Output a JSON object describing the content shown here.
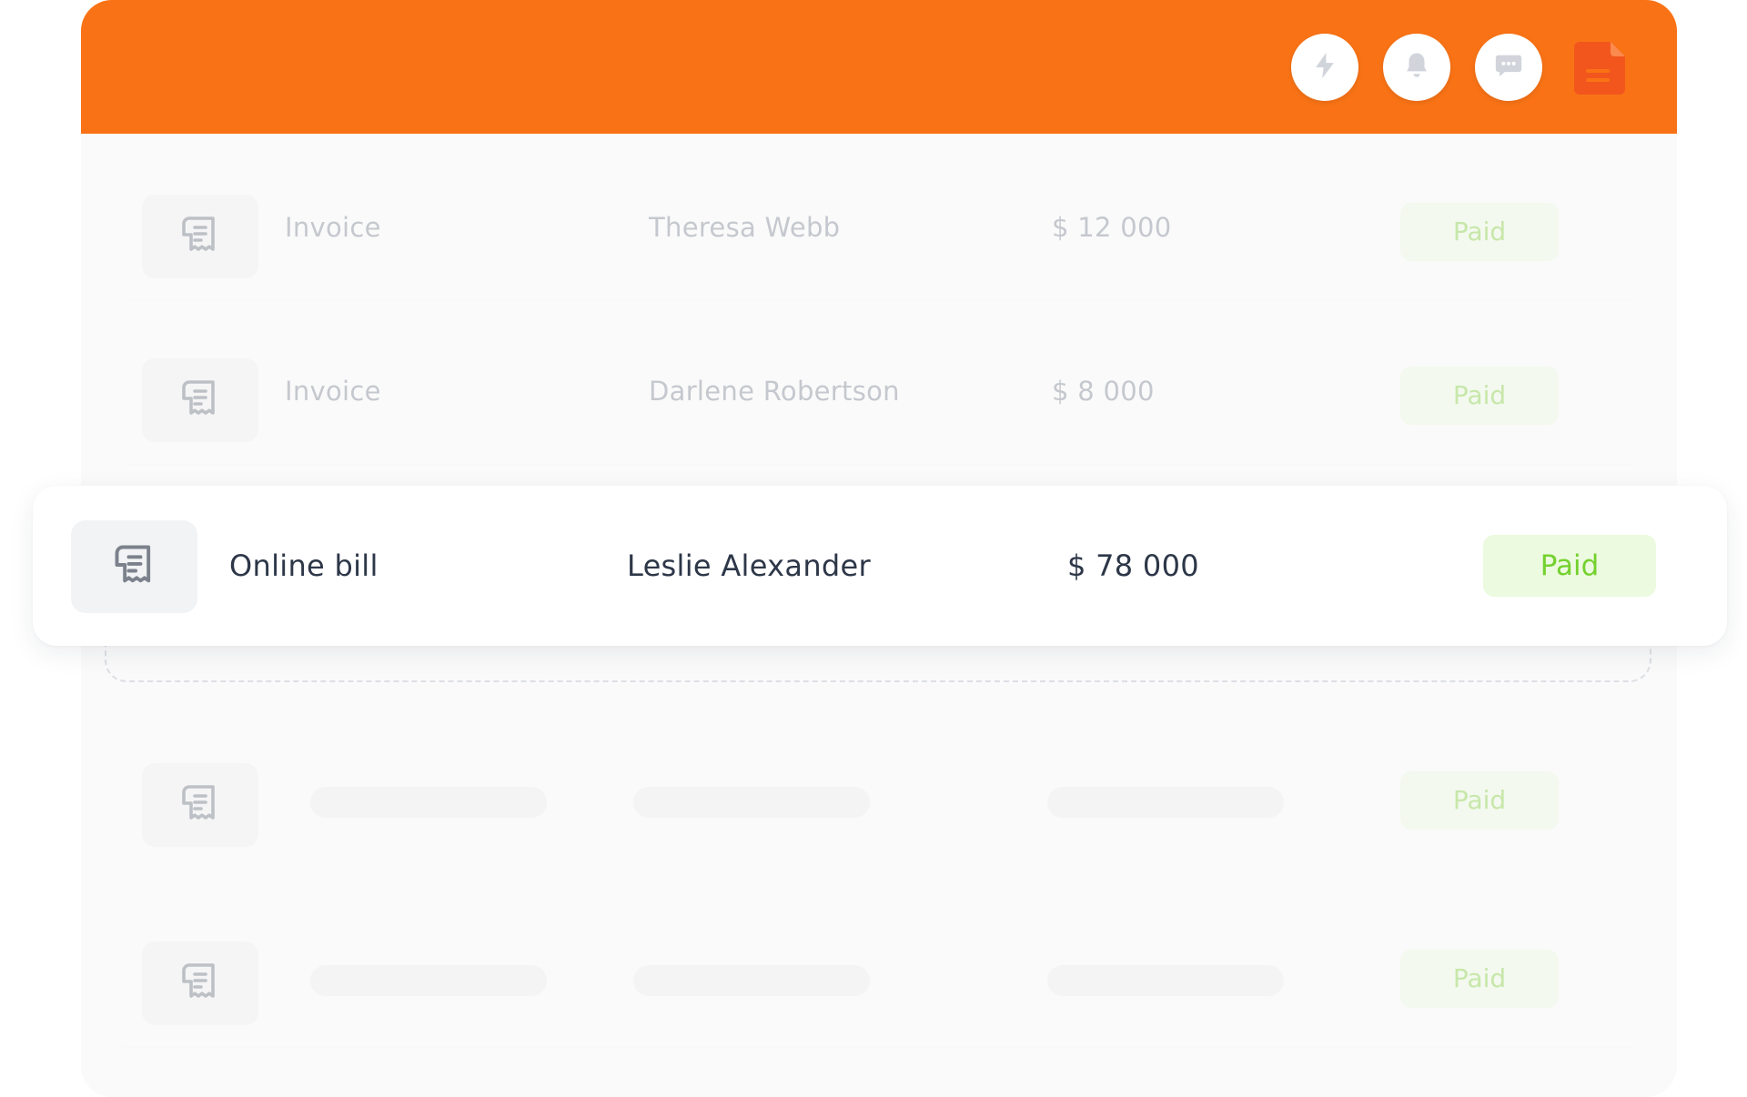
{
  "header": {
    "bg_color": "#f97316",
    "buttons": [
      {
        "icon": "lightning-icon"
      },
      {
        "icon": "bell-icon"
      },
      {
        "icon": "chat-icon"
      }
    ],
    "document_icon_color": "#f2561d"
  },
  "rows": [
    {
      "type": "Invoice",
      "name": "Theresa Webb",
      "amount": "$ 12 000",
      "status": "Paid"
    },
    {
      "type": "Invoice",
      "name": "Darlene Robertson",
      "amount": "$ 8 000",
      "status": "Paid"
    },
    {
      "type": "Online bill",
      "name": "Leslie Alexander",
      "amount": "$ 78 000",
      "status": "Paid"
    },
    {
      "status": "Paid"
    },
    {
      "status": "Paid"
    }
  ],
  "colors": {
    "paid_text": "#74d12f",
    "paid_bg": "#ecfadf",
    "primary_text": "#2d3748"
  }
}
